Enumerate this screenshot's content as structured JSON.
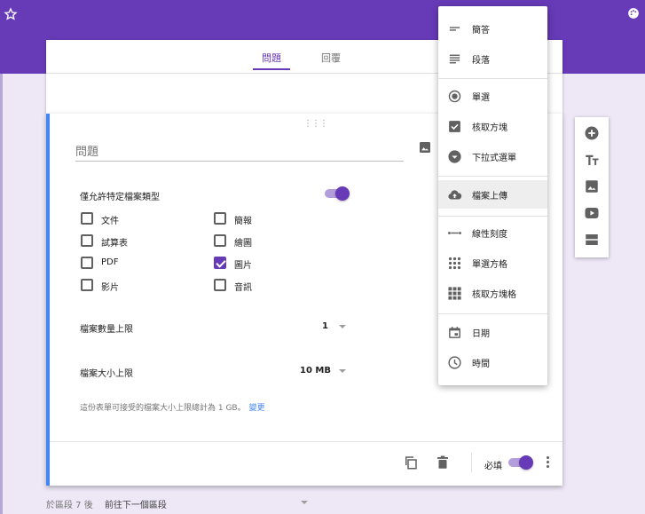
{
  "header": {
    "accent_color": "#673ab7",
    "star_icon": "star-outline-icon",
    "palette_icon": "palette-icon"
  },
  "tabs": [
    {
      "label": "問題",
      "active": true
    },
    {
      "label": "回覆",
      "active": false
    }
  ],
  "question": {
    "placeholder": "問題",
    "allow_specific_types_label": "僅允許特定檔案類型",
    "allow_specific_types_on": true,
    "file_types": [
      {
        "label": "文件",
        "checked": false
      },
      {
        "label": "簡報",
        "checked": false
      },
      {
        "label": "試算表",
        "checked": false
      },
      {
        "label": "繪圖",
        "checked": false
      },
      {
        "label": "PDF",
        "checked": false
      },
      {
        "label": "圖片",
        "checked": true
      },
      {
        "label": "影片",
        "checked": false
      },
      {
        "label": "音訊",
        "checked": false
      }
    ],
    "max_files_label": "檔案數量上限",
    "max_files_value": "1",
    "max_size_label": "檔案大小上限",
    "max_size_value": "10 MB",
    "note": "這份表單可接受的檔案大小上限總計為 1 GB。",
    "change_link": "變更",
    "required_label": "必填",
    "required_on": true
  },
  "type_menu": [
    {
      "label": "簡答",
      "icon": "short-answer-icon"
    },
    {
      "label": "段落",
      "icon": "paragraph-icon"
    },
    {
      "label": "單選",
      "icon": "radio-button-icon"
    },
    {
      "label": "核取方塊",
      "icon": "checkbox-icon"
    },
    {
      "label": "下拉式選單",
      "icon": "dropdown-icon"
    },
    {
      "label": "檔案上傳",
      "icon": "cloud-upload-icon",
      "highlighted": true
    },
    {
      "label": "線性刻度",
      "icon": "linear-scale-icon"
    },
    {
      "label": "單選方格",
      "icon": "grid-dots-icon"
    },
    {
      "label": "核取方塊格",
      "icon": "grid-squares-icon"
    },
    {
      "label": "日期",
      "icon": "calendar-icon"
    },
    {
      "label": "時間",
      "icon": "clock-icon"
    }
  ],
  "sidebar": [
    "add-question-icon",
    "add-title-icon",
    "add-image-icon",
    "add-video-icon",
    "add-section-icon"
  ],
  "section_footer": {
    "after_label": "於區段 7 後",
    "action": "前往下一個區段"
  }
}
